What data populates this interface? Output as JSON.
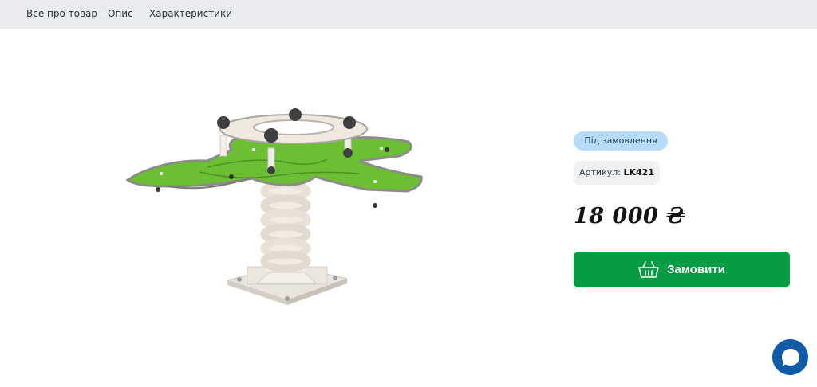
{
  "tabs": [
    {
      "label": "Все про товар"
    },
    {
      "label": "Опис"
    },
    {
      "label": "Характеристики"
    }
  ],
  "product": {
    "availability_badge": "Під замовлення",
    "sku_label": "Артикул:",
    "sku_value": "LK421",
    "price": "18 000 ₴",
    "order_button_label": "Замовити"
  },
  "icons": {
    "order_button": "basket-icon",
    "chat": "chat-bubble-icon"
  },
  "colors": {
    "accent_green": "#079b44",
    "badge_blue": "#b6dcfb",
    "chat_blue": "#0f5ba8",
    "tabs_bg": "#e9ebee"
  }
}
